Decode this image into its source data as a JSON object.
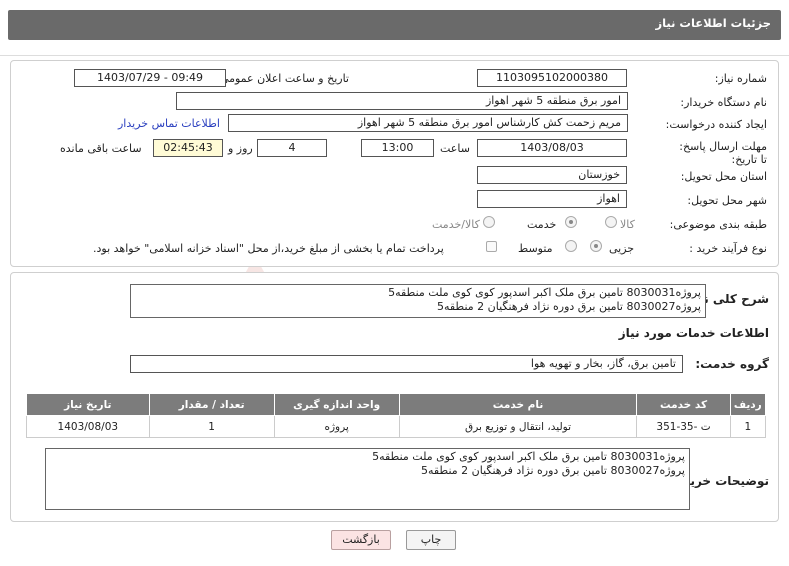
{
  "header": {
    "title": "جزئیات اطلاعات نیاز"
  },
  "form": {
    "need_number_label": "شماره نیاز:",
    "need_number": "1103095102000380",
    "announce_label": "تاریخ و ساعت اعلان عمومی:",
    "announce_value": "1403/07/29 - 09:49",
    "buyer_org_label": "نام دستگاه خریدار:",
    "buyer_org": "امور برق منطقه 5 شهر اهواز",
    "creator_label": "ایجاد کننده درخواست:",
    "creator": "مریم زحمت کش کارشناس امور برق منطقه 5 شهر اهواز",
    "contact_link": "اطلاعات تماس خریدار",
    "deadline_label": "مهلت ارسال پاسخ: تا تاریخ:",
    "deadline_date": "1403/08/03",
    "time_label": "ساعت",
    "deadline_time": "13:00",
    "days_value": "4",
    "days_label": "روز و",
    "remaining_time": "02:45:43",
    "remaining_label": "ساعت باقی مانده",
    "province_label": "استان محل تحویل:",
    "province": "خوزستان",
    "city_label": "شهر محل تحویل:",
    "city": "اهواز",
    "category_label": "طبقه بندی موضوعی:",
    "category_options": [
      "کالا",
      "خدمت",
      "کالا/خدمت"
    ],
    "category_selected": "خدمت",
    "process_label": "نوع فرآیند خرید :",
    "process_options": [
      "جزیی",
      "متوسط"
    ],
    "process_selected": "جزیی",
    "payment_note": "پرداخت تمام یا بخشی از مبلغ خرید،از محل \"اسناد خزانه اسلامی\" خواهد بود."
  },
  "description": {
    "label": "شرح کلی نیاز:",
    "text": "پروژه8030031 تامین برق ملک اکبر اسدپور کوی کوی ملت منطقه5\nپروژه8030027 تامین برق دوره نژاد فرهنگیان 2 منطقه5"
  },
  "services": {
    "section_title": "اطلاعات خدمات مورد نیاز",
    "group_label": "گروه خدمت:",
    "group_value": "تامین برق، گاز، بخار و تهویه هوا",
    "columns": [
      "ردیف",
      "کد خدمت",
      "نام خدمت",
      "واحد اندازه گیری",
      "تعداد / مقدار",
      "تاریخ نیاز"
    ],
    "rows": [
      [
        "1",
        "ت -35-351",
        "تولید، انتقال و توزیع برق",
        "پروژه",
        "1",
        "1403/08/03"
      ]
    ]
  },
  "buyer_notes": {
    "label": "توضیحات خریدار:",
    "text": "پروژه8030031 تامین برق ملک اکبر اسدپور کوی کوی ملت منطقه5\nپروژه8030027 تامین برق دوره نژاد فرهنگیان 2 منطقه5"
  },
  "buttons": {
    "print": "چاپ",
    "back": "بازگشت"
  },
  "colors": {
    "header": "#6a6a6a",
    "table_header": "#7c7c7c",
    "remaining_bg": "#fffbd6",
    "link": "#2a3fbf",
    "watermark": "#c0392b"
  }
}
